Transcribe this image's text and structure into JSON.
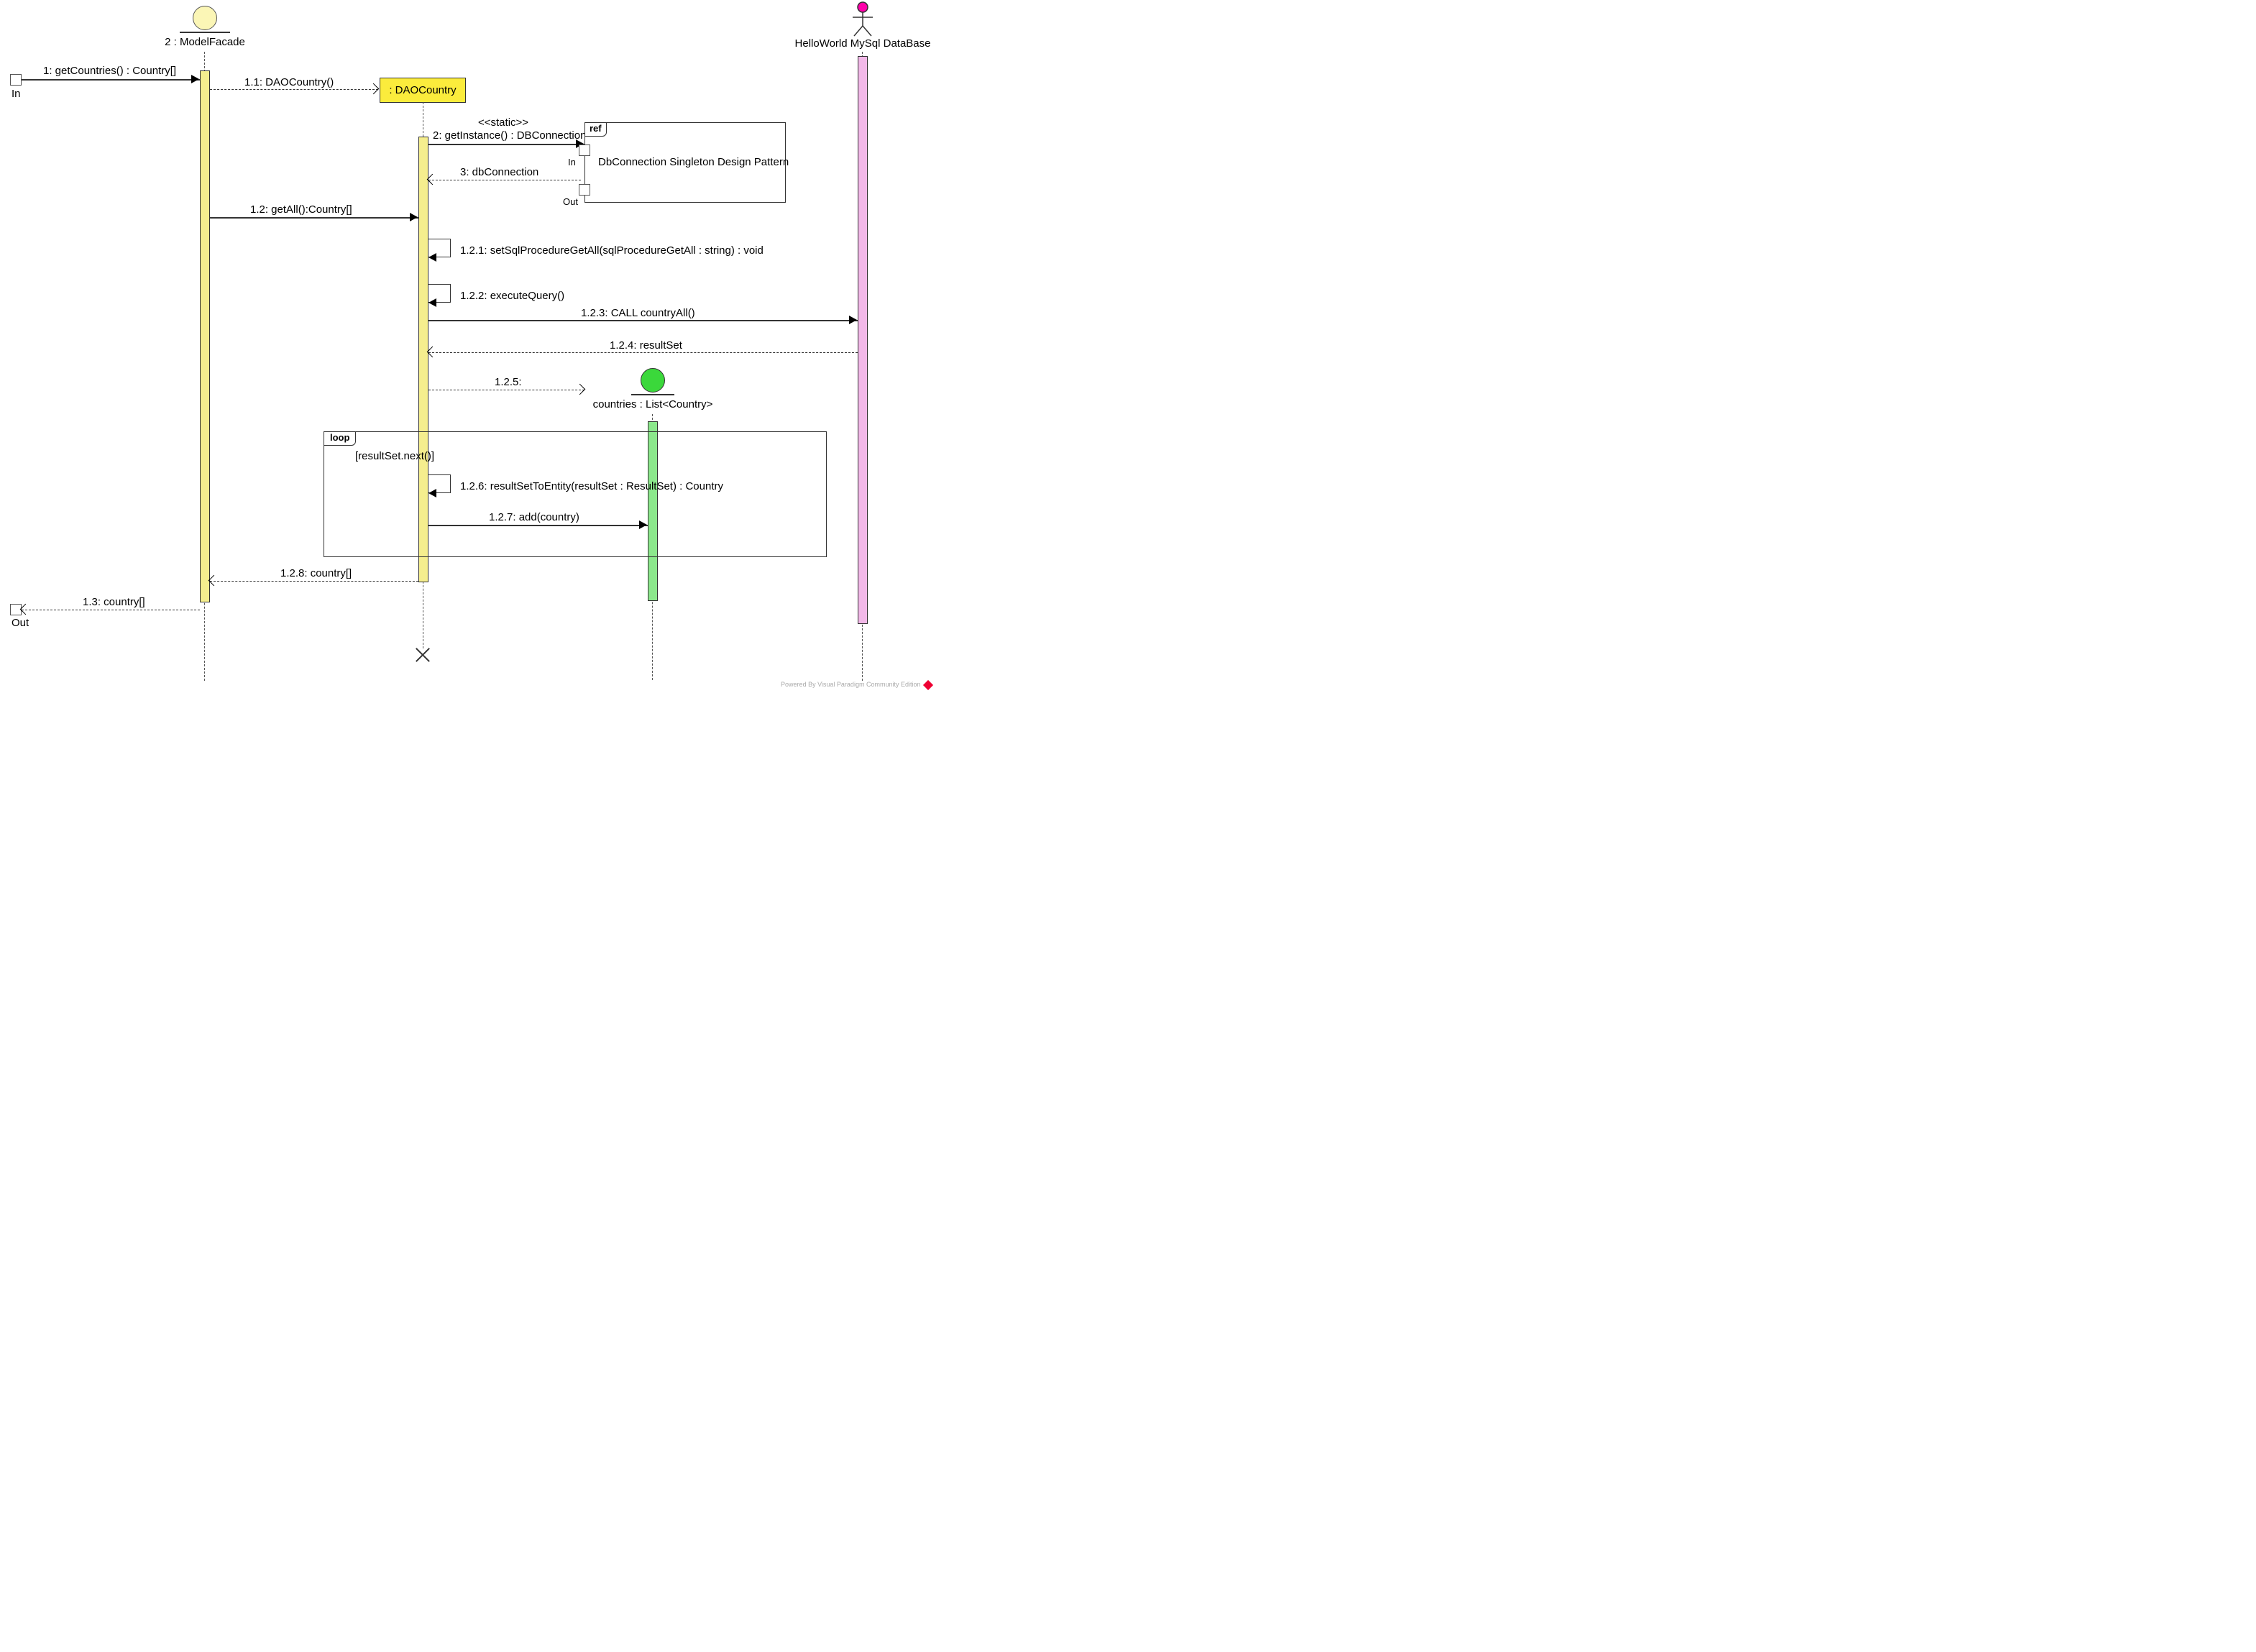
{
  "participants": {
    "modelFacade": "2 : ModelFacade",
    "daoCountry": ": DAOCountry",
    "countriesList": "countries : List<Country>",
    "database": "HelloWorld MySql DataBase"
  },
  "gates": {
    "in": "In",
    "out": "Out"
  },
  "messages": {
    "m1": "1: getCountries() : Country[]",
    "m11": "1.1: DAOCountry()",
    "m2s": "<<static>>",
    "m2": "2: getInstance() : DBConnection",
    "m3": "3: dbConnection",
    "m12": "1.2: getAll():Country[]",
    "m121": "1.2.1: setSqlProcedureGetAll(sqlProcedureGetAll : string) : void",
    "m122": "1.2.2: executeQuery()",
    "m123": "1.2.3: CALL countryAll()",
    "m124": "1.2.4: resultSet",
    "m125": "1.2.5:",
    "m126": "1.2.6: resultSetToEntity(resultSet : ResultSet) : Country",
    "m127": "1.2.7: add(country)",
    "m128": "1.2.8: country[]",
    "m13": "1.3: country[]"
  },
  "fragments": {
    "ref": "ref",
    "refText": "DbConnection Singleton Design Pattern",
    "refIn": "In",
    "refOut": "Out",
    "loop": "loop",
    "loopGuard": "[resultSet.next()]"
  },
  "watermark": "Powered By Visual Paradigm Community Edition"
}
